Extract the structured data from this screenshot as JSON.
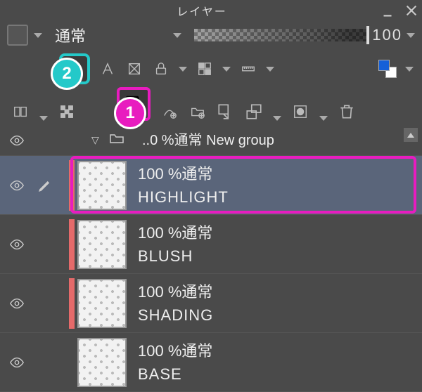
{
  "panel": {
    "title": "レイヤー"
  },
  "blend": {
    "mode": "通常",
    "opacity": "100"
  },
  "group": {
    "info": "..0 %通常",
    "name": "New group"
  },
  "layers": [
    {
      "info": "100 %通常",
      "name": "HIGHLIGHT",
      "selected": true,
      "clip": true
    },
    {
      "info": "100 %通常",
      "name": "BLUSH",
      "selected": false,
      "clip": true
    },
    {
      "info": "100 %通常",
      "name": "SHADING",
      "selected": false,
      "clip": true
    },
    {
      "info": "100 %通常",
      "name": "BASE",
      "selected": false,
      "clip": false
    }
  ],
  "annotations": {
    "one": "1",
    "two": "2"
  }
}
